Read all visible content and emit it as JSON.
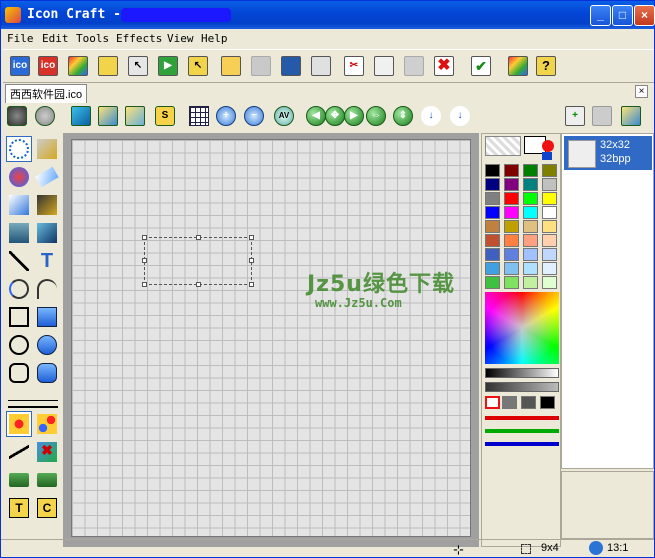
{
  "window": {
    "title": "Icon Craft -",
    "controls": {
      "minimize": "_",
      "maximize": "□",
      "close": "×"
    }
  },
  "menu": [
    "File",
    "Edit",
    "Tools",
    "Effects",
    "View",
    "Help"
  ],
  "toolbar": {
    "items": [
      {
        "name": "ico-format-icon",
        "label": "ico"
      },
      {
        "name": "ico-red-icon",
        "label": "ico"
      },
      {
        "name": "grid-colors-icon",
        "label": ""
      },
      {
        "name": "import-icon",
        "label": ""
      },
      {
        "name": "arrow-icon",
        "label": ""
      },
      {
        "name": "play-icon",
        "label": ""
      },
      {
        "name": "export-icon",
        "label": ""
      },
      {
        "name": "open-icon",
        "label": ""
      },
      {
        "name": "save-disabled-icon",
        "label": ""
      },
      {
        "name": "save-icon",
        "label": ""
      },
      {
        "name": "print-icon",
        "label": ""
      },
      {
        "name": "cut-icon",
        "label": ""
      },
      {
        "name": "copy-icon",
        "label": ""
      },
      {
        "name": "paste-icon",
        "label": ""
      },
      {
        "name": "delete-icon",
        "label": ""
      },
      {
        "name": "check-icon",
        "label": ""
      },
      {
        "name": "palette-icon",
        "label": ""
      },
      {
        "name": "help-icon",
        "label": "?"
      }
    ]
  },
  "tab": {
    "label": "西西软件园.ico",
    "close": "×"
  },
  "subtoolbar": {
    "items": [
      {
        "name": "shapes-icon",
        "label": ""
      },
      {
        "name": "cube-icon",
        "label": ""
      },
      {
        "name": "cube-yellow-icon",
        "label": ""
      },
      {
        "name": "cube-outline-icon",
        "label": ""
      },
      {
        "name": "s-shape-icon",
        "label": "S"
      },
      {
        "name": "grid-icon",
        "label": ""
      },
      {
        "name": "zoom-in-icon",
        "label": "+"
      },
      {
        "name": "zoom-out-icon",
        "label": "−"
      },
      {
        "name": "av-icon",
        "label": "AV"
      },
      {
        "name": "arrow-left-icon",
        "label": "◀"
      },
      {
        "name": "move-all-icon",
        "label": "✥"
      },
      {
        "name": "arrow-right-icon",
        "label": "▶"
      },
      {
        "name": "flip-h-icon",
        "label": "⇔"
      },
      {
        "name": "flip-v-icon",
        "label": "⇕"
      },
      {
        "name": "arrow-down-icon",
        "label": "↓"
      },
      {
        "name": "arrow-down2-icon",
        "label": "↓"
      },
      {
        "name": "add-frame-icon",
        "label": "+"
      },
      {
        "name": "frames-icon",
        "label": ""
      },
      {
        "name": "layers-icon",
        "label": ""
      }
    ]
  },
  "lefttools": [
    "marquee-select-icon",
    "eyedropper-icon",
    "fill-bucket-icon",
    "eraser-icon",
    "pencil-icon",
    "brush-icon",
    "spray-icon",
    "blur-icon",
    "line-icon",
    "text-icon",
    "arc-icon",
    "curve-icon",
    "rect-outline-icon",
    "rect-fill-icon",
    "ellipse-outline-icon",
    "ellipse-fill-icon",
    "roundrect-outline-icon",
    "roundrect-fill-icon",
    "line-width-icon",
    "",
    "dot-fill-icon",
    "dots-icon",
    "diagonal-line-icon",
    "check-shape-icon",
    "stamp-icon",
    "stamp2-icon",
    "lock-t-icon",
    "lock-c-icon"
  ],
  "canvas": {
    "watermark_title": "Jz5u绿色下载",
    "watermark_url": "www.Jz5u.Com"
  },
  "palette": {
    "colors": [
      "#000000",
      "#800000",
      "#008000",
      "#808000",
      "#000080",
      "#800080",
      "#008080",
      "#c0c0c0",
      "#808080",
      "#ff0000",
      "#00ff00",
      "#ffff00",
      "#0000ff",
      "#ff00ff",
      "#00ffff",
      "#ffffff",
      "#c08040",
      "#c0a000",
      "#e0c080",
      "#ffe080",
      "#c05030",
      "#ff8040",
      "#ffa080",
      "#ffd0b0",
      "#4060c0",
      "#6080e0",
      "#a0c0ff",
      "#c0d8ff",
      "#40a0e0",
      "#80c0f0",
      "#b0e0ff",
      "#e0f0ff",
      "#40c040",
      "#80e060",
      "#c0f0a0",
      "#e0ffd0"
    ],
    "fg_color": "#ffffff",
    "bg_color": "#000000"
  },
  "formats": [
    {
      "size": "32x32",
      "depth": "32bpp"
    }
  ],
  "status": {
    "cursor_icon": "crosshair-icon",
    "size": "9x4",
    "zoom": "13:1"
  }
}
